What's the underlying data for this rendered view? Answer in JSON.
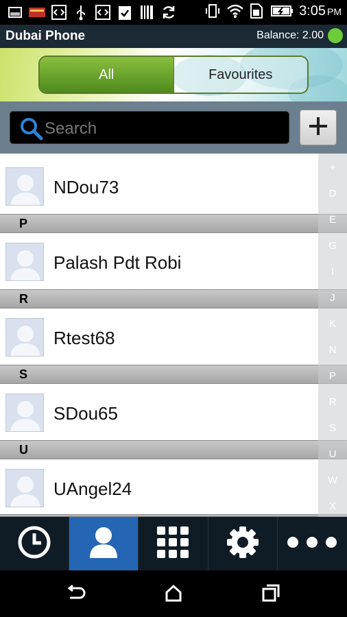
{
  "status_bar": {
    "time": "3:05",
    "ampm": "PM",
    "left_icons": [
      "gallery-icon",
      "mail-icon",
      "code-icon",
      "usb-icon",
      "code-icon",
      "clipboard-icon",
      "barcode-icon",
      "sync-icon"
    ],
    "right_icons": [
      "vibrate-icon",
      "wifi-icon",
      "sim-icon",
      "battery-icon"
    ]
  },
  "app": {
    "title": "Dubai Phone",
    "balance": "Balance: 2.00",
    "status_color": "#6dcc3a"
  },
  "tabs": [
    {
      "label": "All",
      "active": true
    },
    {
      "label": "Favourites",
      "active": false
    }
  ],
  "search": {
    "placeholder": "Search"
  },
  "contacts": [
    {
      "type": "contact",
      "name": "NDou73"
    },
    {
      "type": "section",
      "letter": "P"
    },
    {
      "type": "contact",
      "name": "Palash Pdt Robi"
    },
    {
      "type": "section",
      "letter": "R"
    },
    {
      "type": "contact",
      "name": "Rtest68"
    },
    {
      "type": "section",
      "letter": "S"
    },
    {
      "type": "contact",
      "name": "SDou65"
    },
    {
      "type": "section",
      "letter": "U"
    },
    {
      "type": "contact",
      "name": "UAngel24"
    }
  ],
  "index_letters": [
    "+",
    "D",
    "E",
    "G",
    "I",
    "J",
    "K",
    "N",
    "P",
    "R",
    "S",
    "U",
    "W",
    "X"
  ],
  "bottom_nav": [
    {
      "icon": "clock-icon",
      "active": false
    },
    {
      "icon": "contacts-icon",
      "active": true
    },
    {
      "icon": "dialpad-icon",
      "active": false
    },
    {
      "icon": "gear-icon",
      "active": false
    },
    {
      "icon": "more-icon",
      "active": false
    }
  ],
  "colors": {
    "accent": "#2566b4",
    "tab_green": "#6aa52c"
  }
}
